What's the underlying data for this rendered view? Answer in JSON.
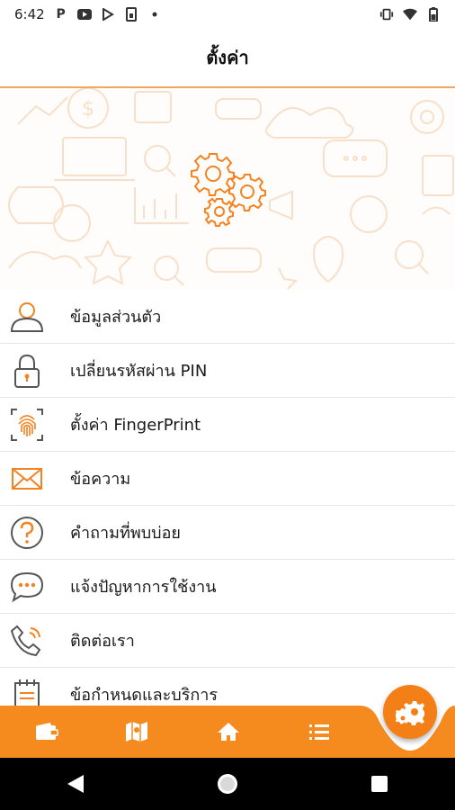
{
  "status_bar": {
    "time": "6:42",
    "left_icons": [
      "p-icon",
      "youtube-icon",
      "play-store-icon",
      "sim-icon",
      "dot-icon"
    ],
    "right_icons": [
      "vibrate-icon",
      "wifi-icon",
      "battery-icon"
    ]
  },
  "header": {
    "title": "ตั้งค่า"
  },
  "menu": [
    {
      "label": "ข้อมูลส่วนตัว",
      "icon": "person-icon"
    },
    {
      "label": "เปลี่ยนรหัสผ่าน PIN",
      "icon": "lock-icon"
    },
    {
      "label": "ตั้งค่า FingerPrint",
      "icon": "fingerprint-icon"
    },
    {
      "label": "ข้อความ",
      "icon": "mail-icon"
    },
    {
      "label": "คำถามที่พบบ่อย",
      "icon": "question-icon"
    },
    {
      "label": "แจ้งปัญหาการใช้งาน",
      "icon": "chat-icon"
    },
    {
      "label": "ติดต่อเรา",
      "icon": "phone-icon"
    },
    {
      "label": "ข้อกำหนดและบริการ",
      "icon": "calendar-icon"
    }
  ],
  "bottom_nav": {
    "items": [
      "wallet-icon",
      "map-icon",
      "home-icon",
      "list-icon"
    ],
    "fab_icon": "gears-icon"
  },
  "colors": {
    "accent": "#f57f17",
    "icon_gray": "#555555",
    "divider": "#e6e6e6"
  }
}
